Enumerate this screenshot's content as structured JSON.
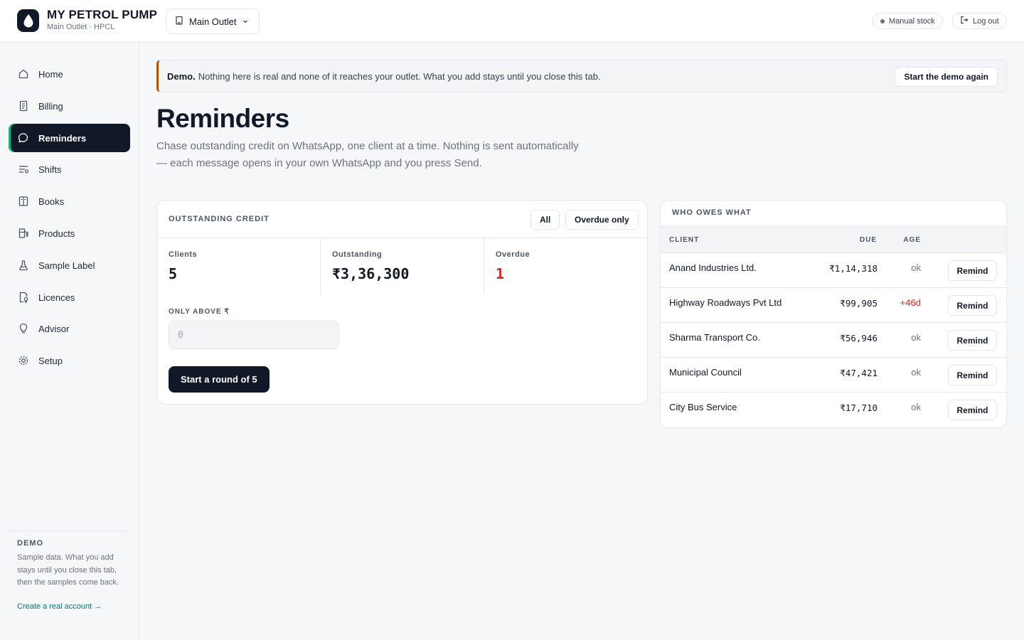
{
  "app": {
    "title": "MY PETROL PUMP",
    "subtitle": "Main Outlet · HPCL",
    "outlet_select": "Main Outlet",
    "manual_stock": "Manual stock",
    "logout": "Log out"
  },
  "sidebar": {
    "items": [
      {
        "label": "Home",
        "icon": "home-icon"
      },
      {
        "label": "Billing",
        "icon": "receipt-icon"
      },
      {
        "label": "Reminders",
        "icon": "chat-bubble-icon",
        "active": true
      },
      {
        "label": "Shifts",
        "icon": "shifts-icon"
      },
      {
        "label": "Books",
        "icon": "book-icon"
      },
      {
        "label": "Products",
        "icon": "fuel-pump-icon"
      },
      {
        "label": "Sample Label",
        "icon": "flask-icon"
      },
      {
        "label": "Licences",
        "icon": "certificate-icon"
      },
      {
        "label": "Advisor",
        "icon": "lightbulb-icon"
      },
      {
        "label": "Setup",
        "icon": "gear-icon"
      }
    ],
    "demo": {
      "title": "DEMO",
      "text": "Sample data. What you add stays until you close this tab, then the samples come back.",
      "link": "Create a real account →"
    }
  },
  "banner": {
    "bold": "Demo.",
    "text": "Nothing here is real and none of it reaches your outlet. What you add stays until you close this tab.",
    "button": "Start the demo again"
  },
  "page": {
    "title": "Reminders",
    "description": "Chase outstanding credit on WhatsApp, one client at a time. Nothing is sent automatically — each message opens in your own WhatsApp and you press Send."
  },
  "credit": {
    "heading": "OUTSTANDING CREDIT",
    "filter_all": "All",
    "filter_overdue": "Overdue only",
    "stats": {
      "clients_label": "Clients",
      "clients_value": "5",
      "outstanding_label": "Outstanding",
      "outstanding_value": "₹3,36,300",
      "overdue_label": "Overdue",
      "overdue_value": "1"
    },
    "only_above_label": "ONLY ABOVE ₹",
    "only_above_placeholder": "0",
    "start_button": "Start a round of 5"
  },
  "owes": {
    "heading": "WHO OWES WHAT",
    "columns": {
      "client": "CLIENT",
      "due": "DUE",
      "age": "AGE"
    },
    "remind_label": "Remind",
    "rows": [
      {
        "client": "Anand Industries Ltd.",
        "due": "₹1,14,318",
        "age": "ok"
      },
      {
        "client": "Highway Roadways Pvt Ltd",
        "due": "₹99,905",
        "age": "+46d"
      },
      {
        "client": "Sharma Transport Co.",
        "due": "₹56,946",
        "age": "ok"
      },
      {
        "client": "Municipal Council",
        "due": "₹47,421",
        "age": "ok"
      },
      {
        "client": "City Bus Service",
        "due": "₹17,710",
        "age": "ok"
      }
    ]
  },
  "colors": {
    "accent_dark": "#111827",
    "overdue_red": "#dc2626",
    "banner_border": "#b45309",
    "link_teal": "#0f766e",
    "active_indicator": "#10b981"
  }
}
